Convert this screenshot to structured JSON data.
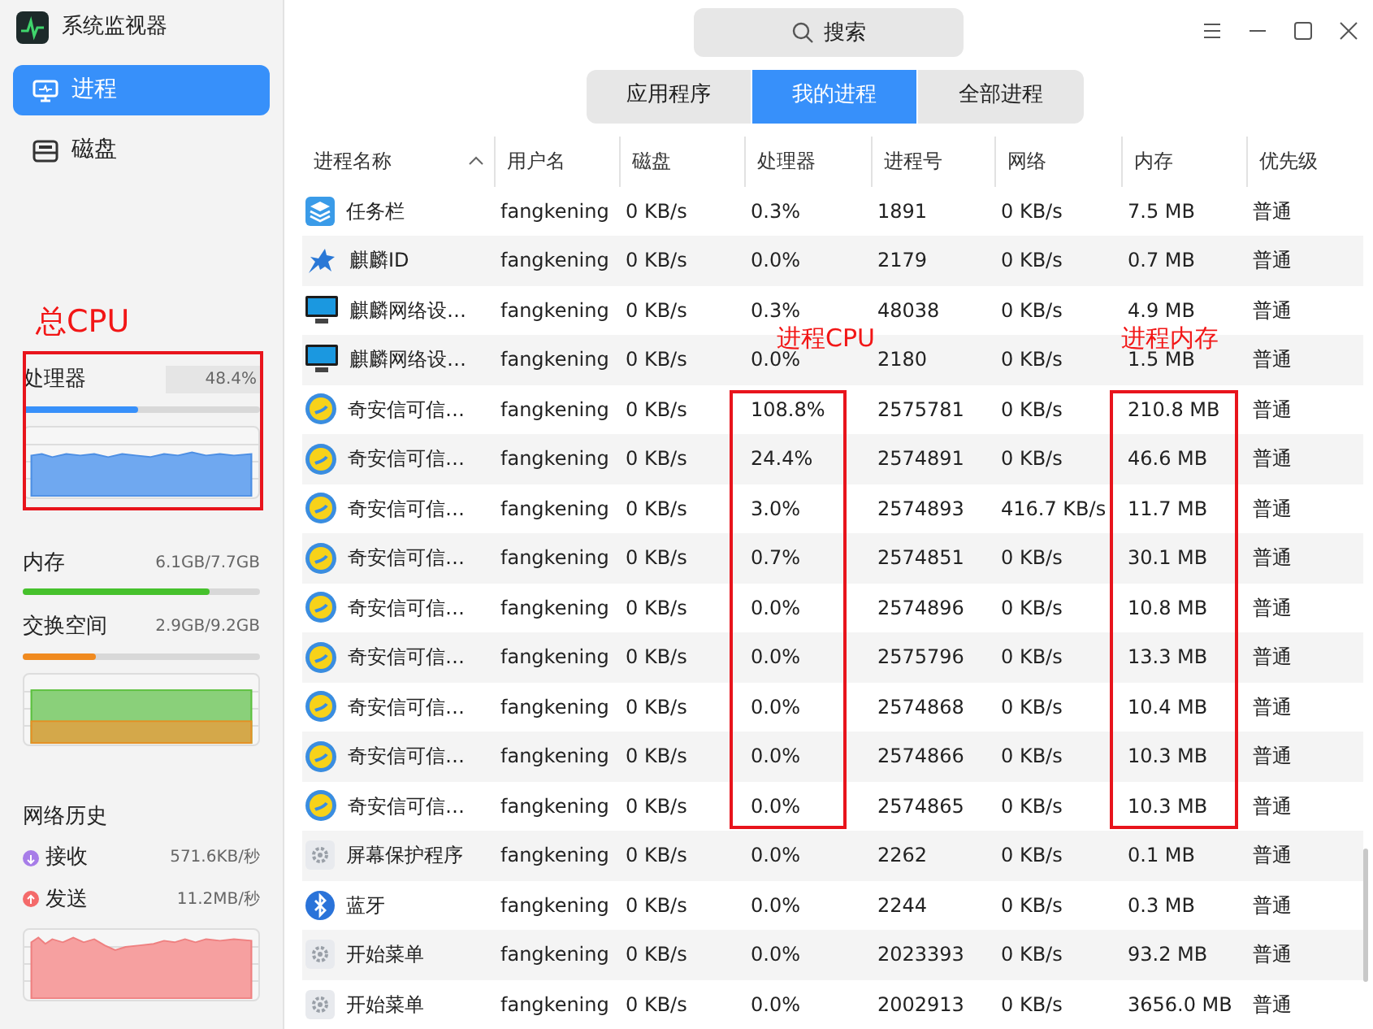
{
  "window": {
    "title": "系统监视器"
  },
  "sidebar": {
    "items": [
      {
        "label": "进程",
        "kind": "monitor",
        "selected": true
      },
      {
        "label": "磁盘",
        "kind": "disk",
        "selected": false
      }
    ],
    "cpu": {
      "label": "处理器",
      "reading": "48.4%",
      "level": 0.484
    },
    "memory": {
      "label": "内存",
      "reading": "6.1GB/7.7GB",
      "level": 0.79
    },
    "swap": {
      "label": "交换空间",
      "reading": "2.9GB/9.2GB",
      "level": 0.31
    },
    "network": {
      "title": "网络历史",
      "receive": {
        "label": "接收",
        "reading": "571.6KB/秒"
      },
      "send": {
        "label": "发送",
        "reading": "11.2MB/秒"
      }
    }
  },
  "search": {
    "placeholder": "搜索"
  },
  "tabs": [
    {
      "label": "应用程序",
      "selected": false
    },
    {
      "label": "我的进程",
      "selected": true
    },
    {
      "label": "全部进程",
      "selected": false
    }
  ],
  "table": {
    "columns": [
      "进程名称",
      "用户名",
      "磁盘",
      "处理器",
      "进程号",
      "网络",
      "内存",
      "优先级"
    ],
    "rows": [
      {
        "kind": "stack",
        "cells": [
          "任务栏",
          "fangkening",
          "0 KB/s",
          "0.3%",
          "1891",
          "0 KB/s",
          "7.5 MB",
          "普通"
        ]
      },
      {
        "kind": "kylin",
        "cells": [
          "麒麟ID",
          "fangkening",
          "0 KB/s",
          "0.0%",
          "2179",
          "0 KB/s",
          "0.7 MB",
          "普通"
        ]
      },
      {
        "kind": "monitor",
        "cells": [
          "麒麟网络设…",
          "fangkening",
          "0 KB/s",
          "0.3%",
          "48038",
          "0 KB/s",
          "4.9 MB",
          "普通"
        ]
      },
      {
        "kind": "monitor",
        "cells": [
          "麒麟网络设…",
          "fangkening",
          "0 KB/s",
          "0.0%",
          "2180",
          "0 KB/s",
          "1.5 MB",
          "普通"
        ]
      },
      {
        "kind": "qax",
        "cells": [
          "奇安信可信…",
          "fangkening",
          "0 KB/s",
          "108.8%",
          "2575781",
          "0 KB/s",
          "210.8 MB",
          "普通"
        ]
      },
      {
        "kind": "qax",
        "cells": [
          "奇安信可信…",
          "fangkening",
          "0 KB/s",
          "24.4%",
          "2574891",
          "0 KB/s",
          "46.6 MB",
          "普通"
        ]
      },
      {
        "kind": "qax",
        "cells": [
          "奇安信可信…",
          "fangkening",
          "0 KB/s",
          "3.0%",
          "2574893",
          "416.7 KB/s",
          "11.7 MB",
          "普通"
        ]
      },
      {
        "kind": "qax",
        "cells": [
          "奇安信可信…",
          "fangkening",
          "0 KB/s",
          "0.7%",
          "2574851",
          "0 KB/s",
          "30.1 MB",
          "普通"
        ]
      },
      {
        "kind": "qax",
        "cells": [
          "奇安信可信…",
          "fangkening",
          "0 KB/s",
          "0.0%",
          "2574896",
          "0 KB/s",
          "10.8 MB",
          "普通"
        ]
      },
      {
        "kind": "qax",
        "cells": [
          "奇安信可信…",
          "fangkening",
          "0 KB/s",
          "0.0%",
          "2575796",
          "0 KB/s",
          "13.3 MB",
          "普通"
        ]
      },
      {
        "kind": "qax",
        "cells": [
          "奇安信可信…",
          "fangkening",
          "0 KB/s",
          "0.0%",
          "2574868",
          "0 KB/s",
          "10.4 MB",
          "普通"
        ]
      },
      {
        "kind": "qax",
        "cells": [
          "奇安信可信…",
          "fangkening",
          "0 KB/s",
          "0.0%",
          "2574866",
          "0 KB/s",
          "10.3 MB",
          "普通"
        ]
      },
      {
        "kind": "qax",
        "cells": [
          "奇安信可信…",
          "fangkening",
          "0 KB/s",
          "0.0%",
          "2574865",
          "0 KB/s",
          "10.3 MB",
          "普通"
        ]
      },
      {
        "kind": "gear",
        "cells": [
          "屏幕保护程序",
          "fangkening",
          "0 KB/s",
          "0.0%",
          "2262",
          "0 KB/s",
          "0.1 MB",
          "普通"
        ]
      },
      {
        "kind": "bluetooth",
        "cells": [
          "蓝牙",
          "fangkening",
          "0 KB/s",
          "0.0%",
          "2244",
          "0 KB/s",
          "0.3 MB",
          "普通"
        ]
      },
      {
        "kind": "gear",
        "cells": [
          "开始菜单",
          "fangkening",
          "0 KB/s",
          "0.0%",
          "2023393",
          "0 KB/s",
          "93.2 MB",
          "普通"
        ]
      },
      {
        "kind": "gear",
        "cells": [
          "开始菜单",
          "fangkening",
          "0 KB/s",
          "0.0%",
          "2002913",
          "0 KB/s",
          "3656.0 MB",
          "普通"
        ]
      }
    ]
  },
  "annotations": [
    {
      "kind": "label",
      "text": "总CPU"
    },
    {
      "kind": "label",
      "text": "进程CPU"
    },
    {
      "kind": "label",
      "text": "进程内存"
    },
    {
      "kind": "box"
    },
    {
      "kind": "box"
    },
    {
      "kind": "box"
    }
  ]
}
